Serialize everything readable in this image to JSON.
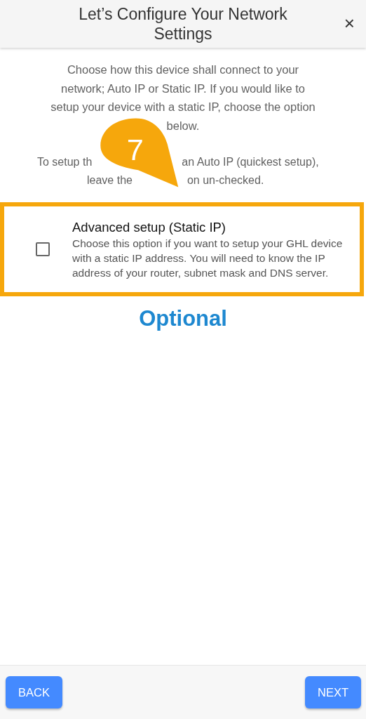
{
  "dialog": {
    "title": "Let’s Configure Your Network Settings",
    "close": "×"
  },
  "intro": "Choose how this device shall connect to your network; Auto IP or Static IP. If you would like to setup your device with a static IP, choose the option below.",
  "hint_lines": [
    {
      "left": "To setup th",
      "right": "an Auto IP (quickest setup),"
    },
    {
      "left": "leave the",
      "right": "on un-checked."
    }
  ],
  "callout": {
    "number": "7"
  },
  "option": {
    "title": "Advanced setup (Static IP)",
    "description": "Choose this option if you want to setup your GHL device with a static IP address. You will need to know the IP address of your router, subnet mask and DNS server.",
    "checked": false
  },
  "note": "Optional",
  "buttons": [
    {
      "label": "BACK"
    },
    {
      "label": "NEXT"
    }
  ]
}
